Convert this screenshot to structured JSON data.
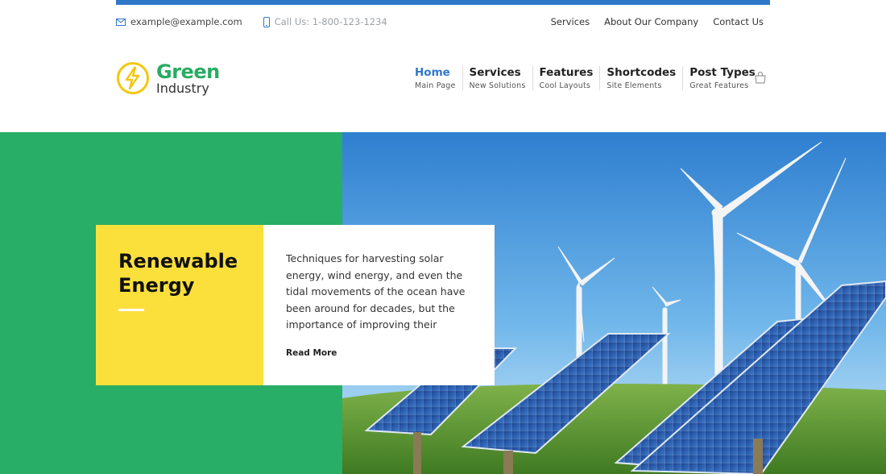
{
  "topbar": {
    "email": "example@example.com",
    "phone": "Call Us: 1-800-123-1234",
    "links": [
      "Services",
      "About Our Company",
      "Contact Us"
    ],
    "accent_color": "#2f77c9"
  },
  "logo": {
    "name_primary": "Green",
    "name_secondary": "Industry",
    "brand_color": "#28ac62",
    "icon_color": "#f3c80c"
  },
  "nav": {
    "items": [
      {
        "label": "Home",
        "sub": "Main Page"
      },
      {
        "label": "Services",
        "sub": "New Solutions"
      },
      {
        "label": "Features",
        "sub": "Cool Layouts"
      },
      {
        "label": "Shortcodes",
        "sub": "Site Elements"
      },
      {
        "label": "Post Types",
        "sub": "Great Features"
      }
    ],
    "active_color": "#2f77c9"
  },
  "hero": {
    "title": "Renewable Energy",
    "text": "Techniques for harvesting solar energy, wind energy, and even the tidal movements of the ocean have been around for decades, but the importance of improving their",
    "read_more": "Read More",
    "green_color": "#28ae66",
    "yellow_color": "#fbe03b"
  }
}
